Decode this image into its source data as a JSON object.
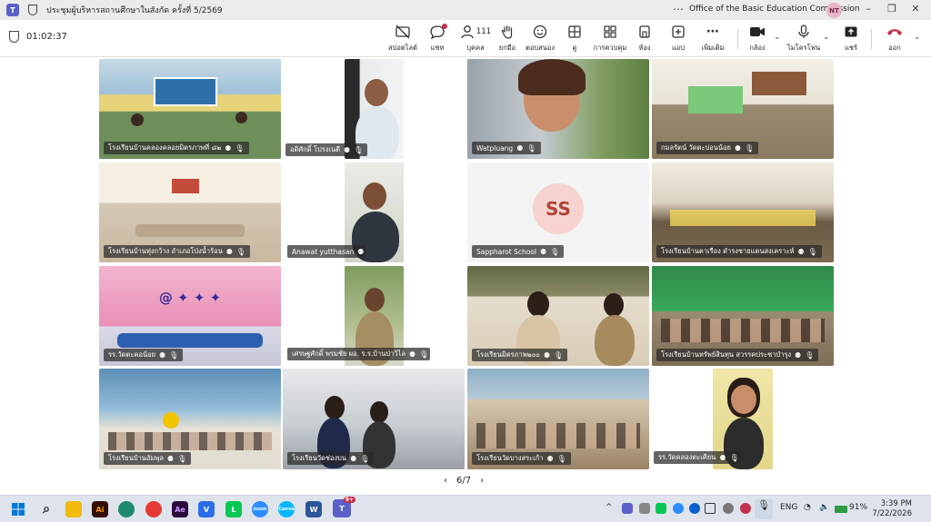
{
  "titlebar": {
    "title": "ประชุมผู้บริหารสถานศึกษาในสังกัด ครั้งที่ 5/2569",
    "organization": "Office of the Basic Education Commission",
    "avatar_initials": "NT"
  },
  "meeting": {
    "timer": "01:02:37",
    "people_count": "111"
  },
  "toolbar": [
    {
      "name": "spotlight-off",
      "label": "สปอตไลต์",
      "icon": "spotlight-off-icon"
    },
    {
      "name": "chat",
      "label": "แชท",
      "icon": "chat-icon",
      "badge": true
    },
    {
      "name": "people",
      "label": "บุคคล",
      "icon": "people-icon"
    },
    {
      "name": "raise-hand",
      "label": "ยกมือ",
      "icon": "hand-icon"
    },
    {
      "name": "react",
      "label": "ตอบสนอง",
      "icon": "smiley-icon"
    },
    {
      "name": "view",
      "label": "ดู",
      "icon": "grid-icon"
    },
    {
      "name": "rooms",
      "label": "การควบคุม",
      "icon": "rooms-icon"
    },
    {
      "name": "share-room",
      "label": "ห้อง",
      "icon": "room-icon"
    },
    {
      "name": "apps",
      "label": "แอป",
      "icon": "plus-square-icon"
    },
    {
      "name": "more",
      "label": "เพิ่มเติม",
      "icon": "more-icon"
    },
    {
      "name": "camera",
      "label": "กล้อง",
      "icon": "camera-icon"
    },
    {
      "name": "mic",
      "label": "ไมโครโฟน",
      "icon": "mic-icon"
    },
    {
      "name": "share",
      "label": "แชร์",
      "icon": "share-icon"
    },
    {
      "name": "leave",
      "label": "ออก",
      "icon": "hangup-icon"
    }
  ],
  "tiles": [
    "โรงเรียนบ้านคลองคลอยมิตรภาพที่ ๘๒",
    "อดิศักดิ์ โปรงเนตี",
    "Watpluang",
    "กมลรัตน์ วัดตะปอนน้อย",
    "โรงเรียนบ้านทุ่งกว้าง อำเภอโป่งน้ำร้อน",
    "Anawat yutthasan",
    "Sappharot School",
    "โรงเรียนบ้านตาเรือง ดำรงชายแดนสงเคราะห์",
    "รร.วัดตะคอน้อย",
    "เศรษฐศักดิ์ พรมชัย ผอ. ร.ร.บ้านป่าวิไล",
    "โรงเรียนมิตรภาพ๒๐๐",
    "โรงเรียนบ้านทรัพย์สินทุน สวรรคประชาบำรุง",
    "โรงเรียนบ้านอัมพุล",
    "โรงเรียนวัดช่องบน",
    "โรงเรียนวัดบางสระเก้า",
    "รร.วัดคลองตะเคียน"
  ],
  "placeholder_avatar": {
    "initials": "SS"
  },
  "pager": {
    "text": "6/7"
  },
  "taskbar": {
    "language": "ENG",
    "battery": "91%",
    "time": "3:39 PM",
    "date": "7/22/2026",
    "teams_badge": "9+"
  }
}
